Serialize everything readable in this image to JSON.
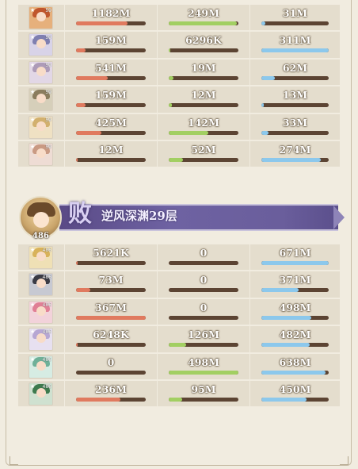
{
  "colors": {
    "red": "#e07a5f",
    "green": "#a2cf62",
    "blue": "#8cc8ec",
    "track": "#5c4433"
  },
  "group1": {
    "rows": [
      {
        "avatar": {
          "hair": "#c0562d",
          "bg": "#e6b07c"
        },
        "level": "59",
        "cols": [
          {
            "value": "1182M",
            "fill": 0.74
          },
          {
            "value": "249M",
            "fill": 0.98
          },
          {
            "value": "31M",
            "fill": 0.06
          }
        ]
      },
      {
        "avatar": {
          "hair": "#7f7fb0",
          "bg": "#d8d3e8"
        },
        "level": "59",
        "cols": [
          {
            "value": "159M",
            "fill": 0.14
          },
          {
            "value": "6296K",
            "fill": 0.02
          },
          {
            "value": "311M",
            "fill": 1.0
          }
        ]
      },
      {
        "avatar": {
          "hair": "#ad9bb8",
          "bg": "#e2d7e6"
        },
        "level": "59",
        "cols": [
          {
            "value": "541M",
            "fill": 0.45
          },
          {
            "value": "19M",
            "fill": 0.07
          },
          {
            "value": "62M",
            "fill": 0.2
          }
        ]
      },
      {
        "avatar": {
          "hair": "#8b7d5e",
          "bg": "#d6cfba"
        },
        "level": "59",
        "cols": [
          {
            "value": "159M",
            "fill": 0.14
          },
          {
            "value": "12M",
            "fill": 0.05
          },
          {
            "value": "13M",
            "fill": 0.04
          }
        ]
      },
      {
        "avatar": {
          "hair": "#d2b06e",
          "bg": "#efe1c3"
        },
        "level": "59",
        "cols": [
          {
            "value": "425M",
            "fill": 0.36
          },
          {
            "value": "142M",
            "fill": 0.57
          },
          {
            "value": "33M",
            "fill": 0.11
          }
        ]
      },
      {
        "avatar": {
          "hair": "#c99a83",
          "bg": "#eedcd4"
        },
        "level": "59",
        "cols": [
          {
            "value": "12M",
            "fill": 0.02
          },
          {
            "value": "52M",
            "fill": 0.21
          },
          {
            "value": "274M",
            "fill": 0.88
          }
        ]
      }
    ]
  },
  "banner": {
    "result": "败",
    "stage": "逆风深渊29层",
    "level": "486"
  },
  "group2": {
    "rows": [
      {
        "avatar": {
          "hair": "#d8b25a",
          "bg": "#efe0b5"
        },
        "level": "486",
        "cols": [
          {
            "value": "5621K",
            "fill": 0.02
          },
          {
            "value": "0",
            "fill": 0
          },
          {
            "value": "671M",
            "fill": 1.0
          }
        ]
      },
      {
        "avatar": {
          "hair": "#3a3b45",
          "bg": "#c7c9d2"
        },
        "level": "486",
        "cols": [
          {
            "value": "73M",
            "fill": 0.2
          },
          {
            "value": "0",
            "fill": 0
          },
          {
            "value": "371M",
            "fill": 0.55
          }
        ]
      },
      {
        "avatar": {
          "hair": "#e07f95",
          "bg": "#f2d2da"
        },
        "level": "486",
        "cols": [
          {
            "value": "367M",
            "fill": 1.0
          },
          {
            "value": "0",
            "fill": 0
          },
          {
            "value": "498M",
            "fill": 0.74
          }
        ]
      },
      {
        "avatar": {
          "hair": "#b7a7d3",
          "bg": "#e7e0f0"
        },
        "level": "486",
        "cols": [
          {
            "value": "6248K",
            "fill": 0.02
          },
          {
            "value": "126M",
            "fill": 0.25
          },
          {
            "value": "482M",
            "fill": 0.72
          }
        ]
      },
      {
        "avatar": {
          "hair": "#6fb098",
          "bg": "#d6ece3"
        },
        "level": "486",
        "cols": [
          {
            "value": "0",
            "fill": 0
          },
          {
            "value": "498M",
            "fill": 1.0
          },
          {
            "value": "638M",
            "fill": 0.95
          }
        ]
      },
      {
        "avatar": {
          "hair": "#3d7a4e",
          "bg": "#cfe1d0"
        },
        "level": "486",
        "cols": [
          {
            "value": "236M",
            "fill": 0.64
          },
          {
            "value": "95M",
            "fill": 0.19
          },
          {
            "value": "450M",
            "fill": 0.67
          }
        ]
      }
    ]
  }
}
